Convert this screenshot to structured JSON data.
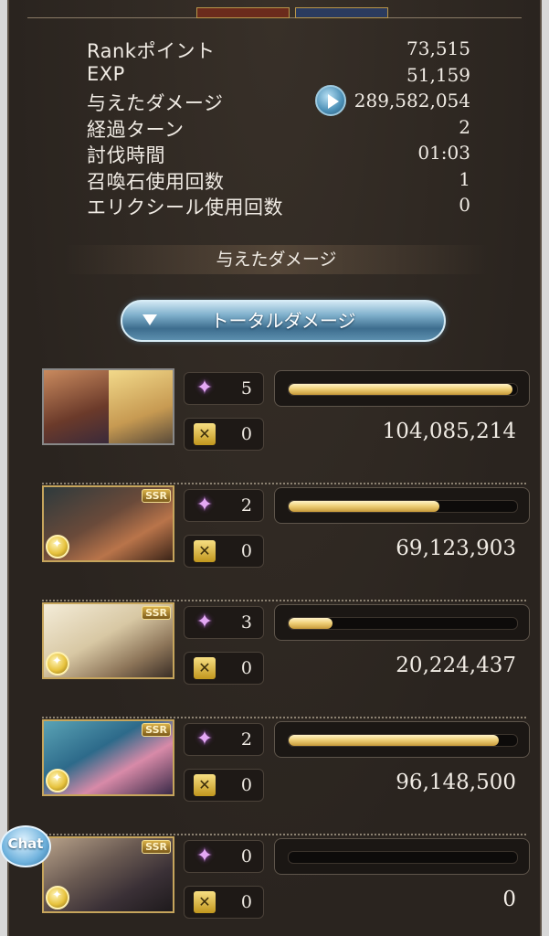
{
  "stats": [
    {
      "label": "Rankポイント",
      "value": "73,515"
    },
    {
      "label": "EXP",
      "value": "51,159"
    },
    {
      "label": "与えたダメージ",
      "value": "289,582,054"
    },
    {
      "label": "経過ターン",
      "value": "2"
    },
    {
      "label": "討伐時間",
      "value": "01:03"
    },
    {
      "label": "召喚石使用回数",
      "value": "1"
    },
    {
      "label": "エリクシール使用回数",
      "value": "0"
    }
  ],
  "section_title": "与えたダメージ",
  "dropdown": {
    "selected": "トータルダメージ"
  },
  "characters": [
    {
      "count_a": "5",
      "count_b": "0",
      "damage": "104,085,214",
      "progress": 0.98,
      "ssr": ""
    },
    {
      "count_a": "2",
      "count_b": "0",
      "damage": "69,123,903",
      "progress": 0.66,
      "ssr": "SSR"
    },
    {
      "count_a": "3",
      "count_b": "0",
      "damage": "20,224,437",
      "progress": 0.19,
      "ssr": "SSR"
    },
    {
      "count_a": "2",
      "count_b": "0",
      "damage": "96,148,500",
      "progress": 0.92,
      "ssr": "SSR"
    },
    {
      "count_a": "0",
      "count_b": "0",
      "damage": "0",
      "progress": 0.0,
      "ssr": "SSR"
    }
  ],
  "chat": {
    "label": "Chat"
  },
  "colors": {
    "panel": "#2a241f",
    "gold": "#f0d17a",
    "accent_blue": "#7fb0cc",
    "text": "#f0ebe4"
  }
}
